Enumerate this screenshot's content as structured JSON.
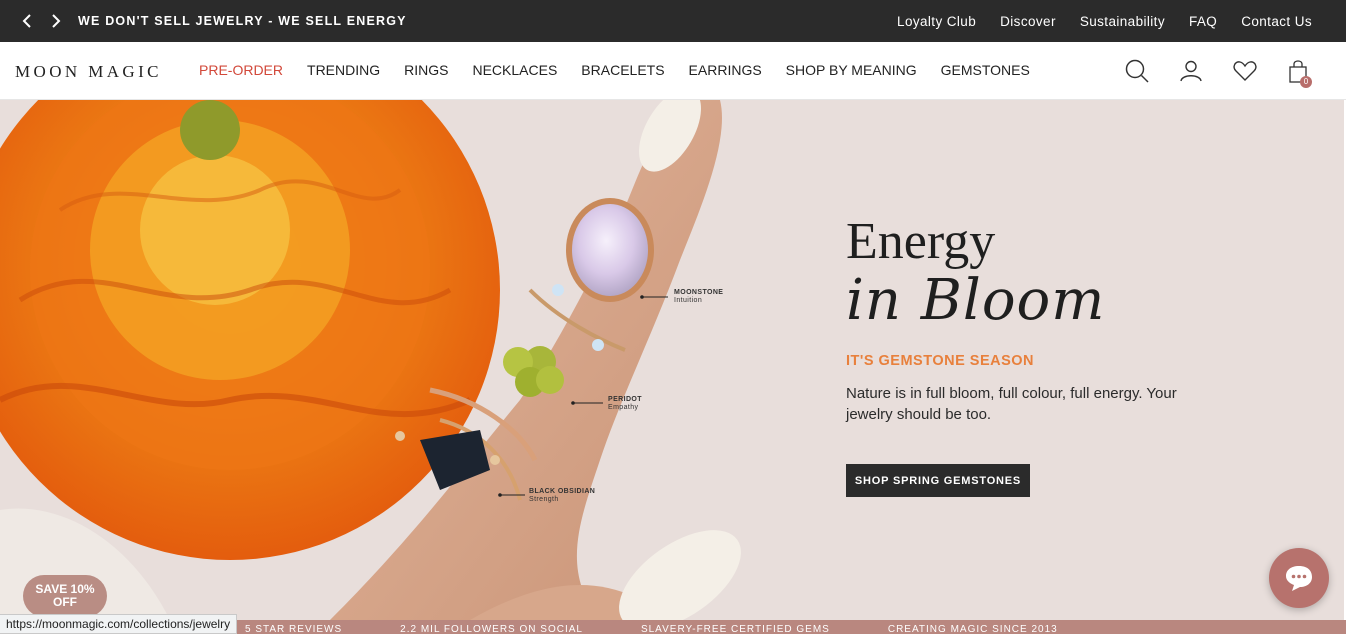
{
  "announcement": {
    "text": "WE DON'T SELL JEWELRY - WE SELL ENERGY",
    "prev_icon": "chevron-left-icon",
    "next_icon": "chevron-right-icon"
  },
  "top_links": [
    "Loyalty Club",
    "Discover",
    "Sustainability",
    "FAQ",
    "Contact Us"
  ],
  "header": {
    "logo": "MOON MAGIC",
    "nav": [
      {
        "label": "PRE-ORDER",
        "active": true
      },
      {
        "label": "TRENDING"
      },
      {
        "label": "RINGS"
      },
      {
        "label": "NECKLACES"
      },
      {
        "label": "BRACELETS"
      },
      {
        "label": "EARRINGS"
      },
      {
        "label": "SHOP BY MEANING"
      },
      {
        "label": "GEMSTONES"
      }
    ],
    "icons": [
      "search-icon",
      "account-icon",
      "wishlist-heart-icon",
      "cart-bag-icon"
    ],
    "cart_count": "0"
  },
  "hero": {
    "title": "Energy",
    "script_title": "in Bloom",
    "eyebrow": "IT'S GEMSTONE SEASON",
    "body": "Nature is in full bloom, full colour, full energy. Your jewelry should be too.",
    "cta": "SHOP SPRING GEMSTONES",
    "callouts": [
      {
        "stone": "MOONSTONE",
        "meaning": "Intuition"
      },
      {
        "stone": "PERIDOT",
        "meaning": "Empathy"
      },
      {
        "stone": "BLACK OBSIDIAN",
        "meaning": "Strength"
      }
    ]
  },
  "save_badge": "SAVE 10% OFF",
  "chat_icon": "chat-bubble-icon",
  "strip": [
    "5 STAR REVIEWS",
    "2.2 MIL FOLLOWERS ON SOCIAL",
    "SLAVERY-FREE CERTIFIED GEMS",
    "CREATING MAGIC SINCE 2013"
  ],
  "status_url": "https://moonmagic.com/collections/jewelry",
  "colors": {
    "topbar": "#2b2b2b",
    "accent_red": "#d2483a",
    "accent_orange": "#e8803c",
    "hero_bg": "#e8dedb",
    "rose": "#b7726d"
  }
}
